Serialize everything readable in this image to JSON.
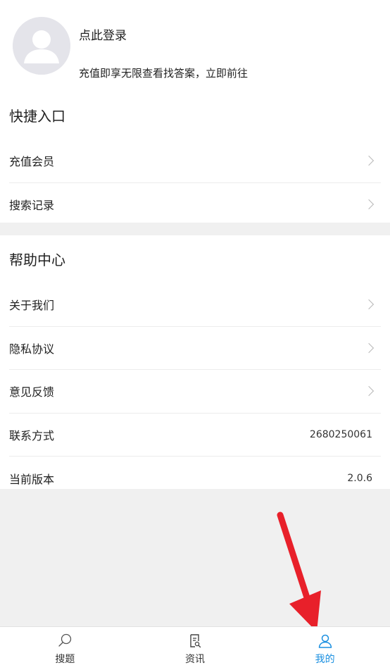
{
  "profile": {
    "login_label": "点此登录",
    "promo_text": "充值即享无限查看找答案，立即前往"
  },
  "quick_entry": {
    "title": "快捷入口",
    "items": [
      {
        "label": "充值会员"
      },
      {
        "label": "搜索记录"
      }
    ]
  },
  "help_center": {
    "title": "帮助中心",
    "items": [
      {
        "label": "关于我们"
      },
      {
        "label": "隐私协议"
      },
      {
        "label": "意见反馈"
      },
      {
        "label": "联系方式",
        "value": "2680250061"
      },
      {
        "label": "当前版本",
        "value": "2.0.6"
      }
    ]
  },
  "bottom_nav": {
    "items": [
      {
        "label": "搜题",
        "icon": "search-icon"
      },
      {
        "label": "资讯",
        "icon": "news-icon"
      },
      {
        "label": "我的",
        "icon": "person-icon",
        "active": true
      }
    ]
  },
  "colors": {
    "active": "#1a8fe0",
    "annotation_arrow": "#e8202a",
    "background": "#f0f0f0"
  }
}
